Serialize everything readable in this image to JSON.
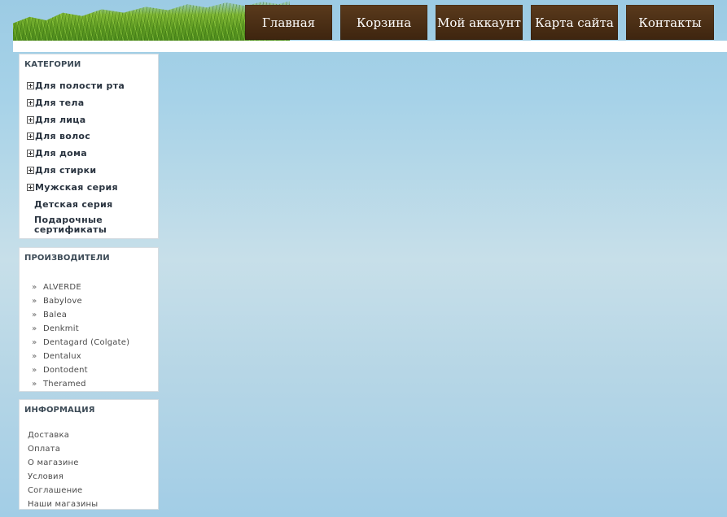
{
  "nav": {
    "items": [
      "Главная",
      "Корзина",
      "Мой аккаунт",
      "Карта сайта",
      "Контакты"
    ]
  },
  "categories": {
    "title": "КАТЕГОРИИ",
    "items": [
      {
        "label": "Для полости рта",
        "expandable": true
      },
      {
        "label": "Для тела",
        "expandable": true
      },
      {
        "label": "Для лица",
        "expandable": true
      },
      {
        "label": "Для волос",
        "expandable": true
      },
      {
        "label": "Для дома",
        "expandable": true
      },
      {
        "label": "Для стирки",
        "expandable": true
      },
      {
        "label": "Мужская серия",
        "expandable": true
      },
      {
        "label": "Детская серия",
        "expandable": false
      },
      {
        "label": "Подарочные сертификаты",
        "expandable": false
      }
    ]
  },
  "manufacturers": {
    "title": "ПРОИЗВОДИТЕЛИ",
    "items": [
      "ALVERDE",
      "Babylove",
      "Balea",
      "Denkmit",
      "Dentagard (Colgate)",
      "Dentalux",
      "Dontodent",
      "Theramed"
    ]
  },
  "information": {
    "title": "ИНФОРМАЦИЯ",
    "items": [
      "Доставка",
      "Оплата",
      "О магазине",
      "Условия",
      "Соглашение",
      "Наши магазины"
    ]
  },
  "colors": {
    "nav_bg": "#4a2f15",
    "sky": "#a6d2e8",
    "grass": "#5d9a22"
  },
  "icons": {
    "expand": "plus-box-icon",
    "bullet": "double-chevron-right-icon"
  }
}
